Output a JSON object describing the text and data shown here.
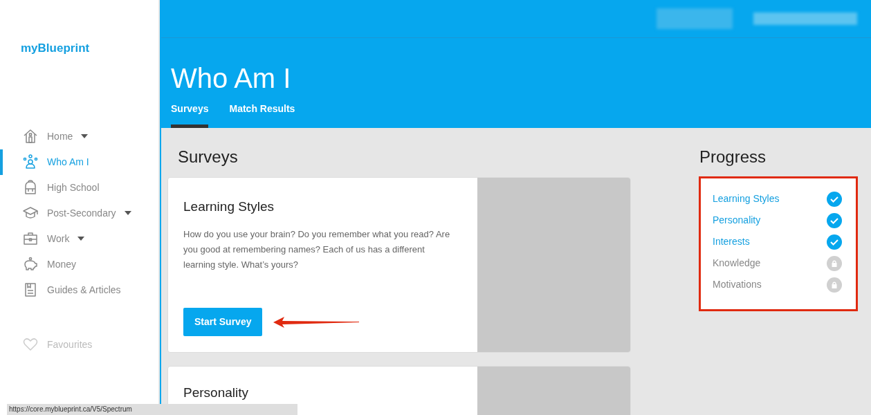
{
  "brand": "myBlueprint",
  "nav": [
    {
      "label": "Home",
      "dropdown": true,
      "selected": false
    },
    {
      "label": "Who Am I",
      "dropdown": false,
      "selected": true
    },
    {
      "label": "High School",
      "dropdown": false,
      "selected": false
    },
    {
      "label": "Post-Secondary",
      "dropdown": true,
      "selected": false
    },
    {
      "label": "Work",
      "dropdown": true,
      "selected": false
    },
    {
      "label": "Money",
      "dropdown": false,
      "selected": false
    },
    {
      "label": "Guides & Articles",
      "dropdown": false,
      "selected": false
    }
  ],
  "favourites": "Favourites",
  "page_title": "Who Am I",
  "tabs": [
    {
      "label": "Surveys",
      "selected": true
    },
    {
      "label": "Match Results",
      "selected": false
    }
  ],
  "surveys_heading": "Surveys",
  "cards": [
    {
      "title": "Learning Styles",
      "text": "How do you use your brain? Do you remember what you read? Are you good at remembering names? Each of us has a different learning style. What’s yours?",
      "button": "Start Survey"
    },
    {
      "title": "Personality"
    }
  ],
  "progress": {
    "title": "Progress",
    "items": [
      {
        "label": "Learning Styles",
        "done": true
      },
      {
        "label": "Personality",
        "done": true
      },
      {
        "label": "Interests",
        "done": true
      },
      {
        "label": "Knowledge",
        "done": false
      },
      {
        "label": "Motivations",
        "done": false
      }
    ]
  },
  "status_bar": "https://core.myblueprint.ca/V5/Spectrum"
}
